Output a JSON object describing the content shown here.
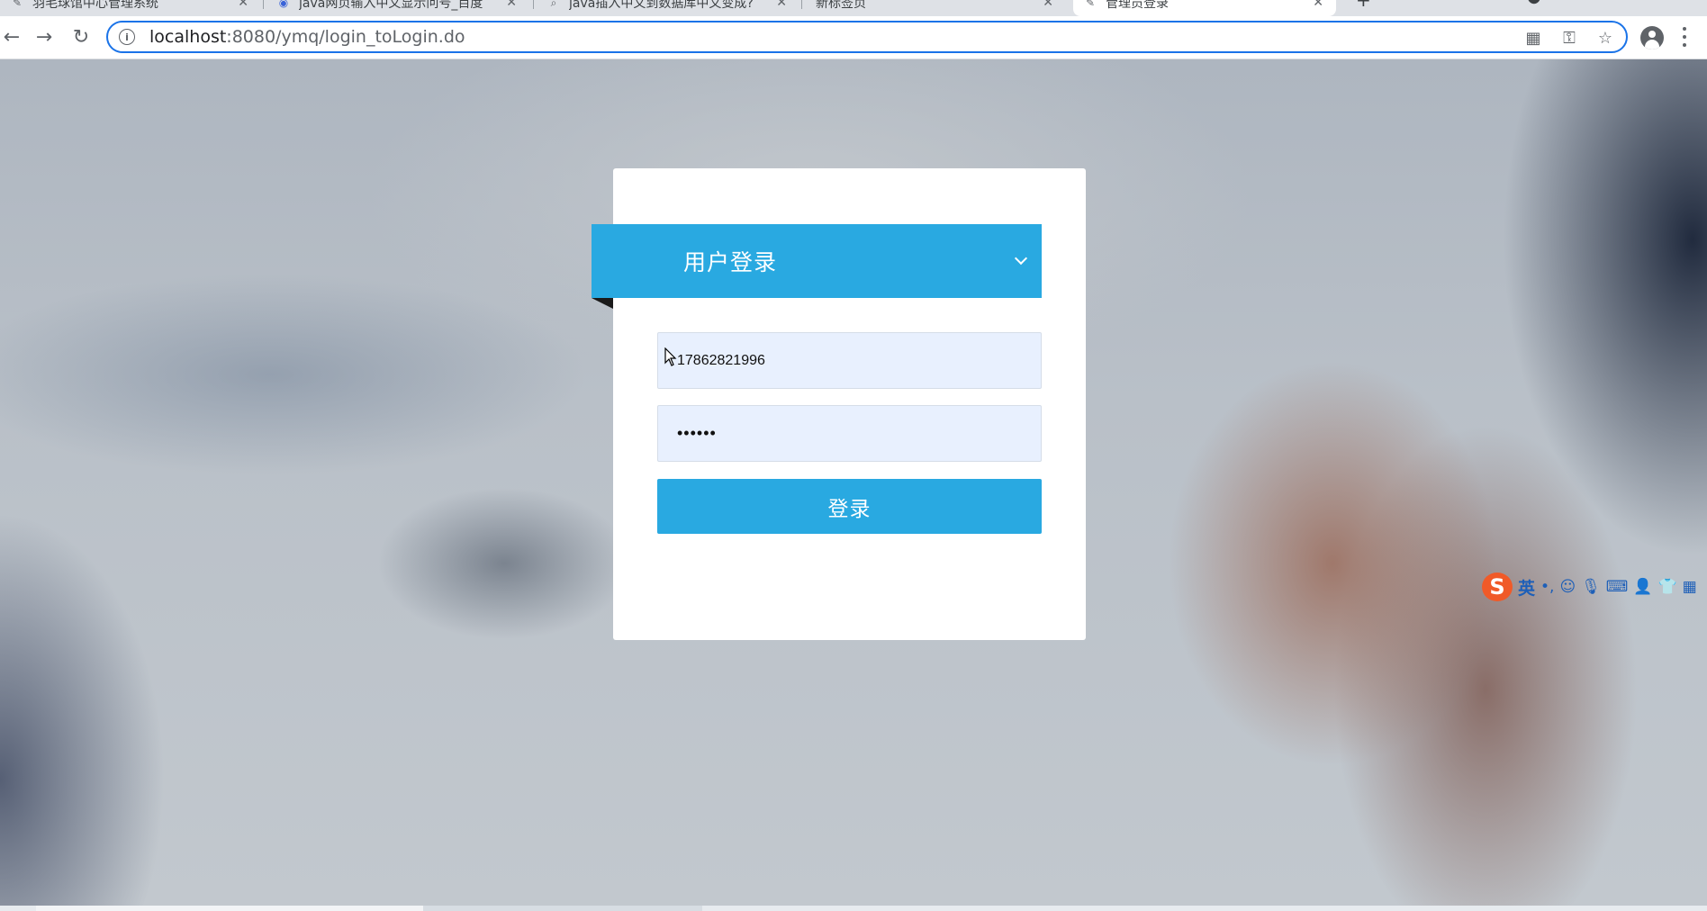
{
  "browser": {
    "tabs": [
      {
        "title": "羽毛球馆中心管理系统",
        "active": false
      },
      {
        "title": "java网页输入中文显示问号_百度",
        "active": false
      },
      {
        "title": "java插入中文到数据库中文变成?",
        "active": false
      },
      {
        "title": "新标签页",
        "active": false
      },
      {
        "title": "管理员登录",
        "active": true
      }
    ],
    "url_host": "localhost",
    "url_path": ":8080/ymq/login_toLogin.do"
  },
  "login": {
    "title": "用户登录",
    "username_value": "17862821996",
    "password_mask": "••••••",
    "submit_label": "登录"
  },
  "ime": {
    "lang_label": "英",
    "logo_letter": "S"
  },
  "colors": {
    "accent": "#29a9e1",
    "input_bg": "#e8f0fe",
    "omnibox_focus": "#1a73e8"
  }
}
